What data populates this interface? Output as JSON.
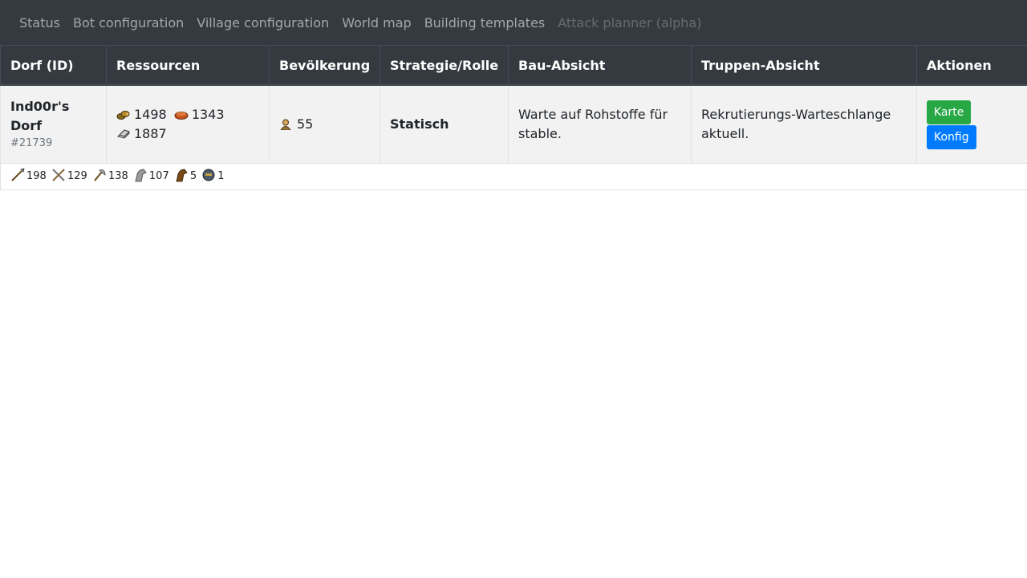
{
  "nav": {
    "items": [
      {
        "label": "Status",
        "disabled": false
      },
      {
        "label": "Bot configuration",
        "disabled": false
      },
      {
        "label": "Village configuration",
        "disabled": false
      },
      {
        "label": "World map",
        "disabled": false
      },
      {
        "label": "Building templates",
        "disabled": false
      },
      {
        "label": "Attack planner (alpha)",
        "disabled": true
      }
    ]
  },
  "table": {
    "headers": [
      "Dorf (ID)",
      "Ressourcen",
      "Bevölkerung",
      "Strategie/Rolle",
      "Bau-Absicht",
      "Truppen-Absicht",
      "Aktionen"
    ],
    "row": {
      "village_name": "Ind00r's Dorf",
      "village_id": "#21739",
      "resources": {
        "wood": "1498",
        "clay": "1343",
        "iron": "1887"
      },
      "population": "55",
      "strategy": "Statisch",
      "build_intent": "Warte auf Rohstoffe für stable.",
      "troop_intent": "Rekrutierungs-Warteschlange aktuell.",
      "actions": {
        "map_label": "Karte",
        "config_label": "Konfig"
      }
    },
    "troops": [
      {
        "icon": "spear-icon",
        "count": "198"
      },
      {
        "icon": "sword-icon",
        "count": "129"
      },
      {
        "icon": "axe-icon",
        "count": "138"
      },
      {
        "icon": "light-cavalry-icon",
        "count": "107"
      },
      {
        "icon": "heavy-cavalry-icon",
        "count": "5"
      },
      {
        "icon": "knight-icon",
        "count": "1"
      }
    ]
  },
  "colors": {
    "navbar": "#343a40",
    "karte_button": "#28a745",
    "konfig_button": "#007bff",
    "row_stripe": "#f2f2f2"
  }
}
